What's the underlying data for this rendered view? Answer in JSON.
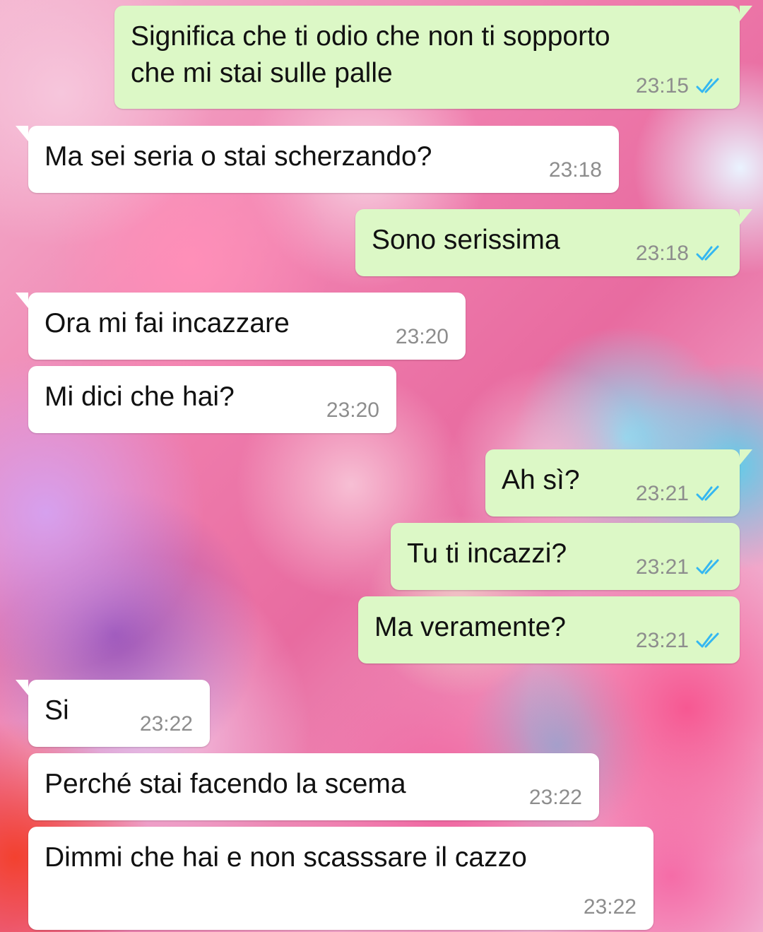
{
  "chat": {
    "messages": [
      {
        "direction": "outgoing",
        "text": "Significa che ti odio che non ti sopporto\nche mi stai sulle palle",
        "time": "23:15",
        "status_icon": "double-check-read-icon"
      },
      {
        "direction": "incoming",
        "text": "Ma sei seria o stai scherzando?",
        "time": "23:18"
      },
      {
        "direction": "outgoing",
        "text": "Sono serissima",
        "time": "23:18",
        "status_icon": "double-check-read-icon"
      },
      {
        "direction": "incoming",
        "text": "Ora mi fai incazzare",
        "time": "23:20"
      },
      {
        "direction": "incoming",
        "text": "Mi dici che hai?",
        "time": "23:20"
      },
      {
        "direction": "outgoing",
        "text": "Ah sì?",
        "time": "23:21",
        "status_icon": "double-check-read-icon"
      },
      {
        "direction": "outgoing",
        "text": "Tu ti incazzi?",
        "time": "23:21",
        "status_icon": "double-check-read-icon"
      },
      {
        "direction": "outgoing",
        "text": "Ma veramente?",
        "time": "23:21",
        "status_icon": "double-check-read-icon"
      },
      {
        "direction": "incoming",
        "text": "Si",
        "time": "23:22"
      },
      {
        "direction": "incoming",
        "text": "Perché stai facendo la scema",
        "time": "23:22"
      },
      {
        "direction": "incoming",
        "text": "Dimmi che hai e non scasssare il cazzo",
        "time": "23:22"
      }
    ]
  },
  "colors": {
    "incoming_bubble": "#ffffff",
    "outgoing_bubble": "#dcf8c6",
    "timestamp": "#8d8d8d",
    "read_ticks": "#34b7f1"
  }
}
